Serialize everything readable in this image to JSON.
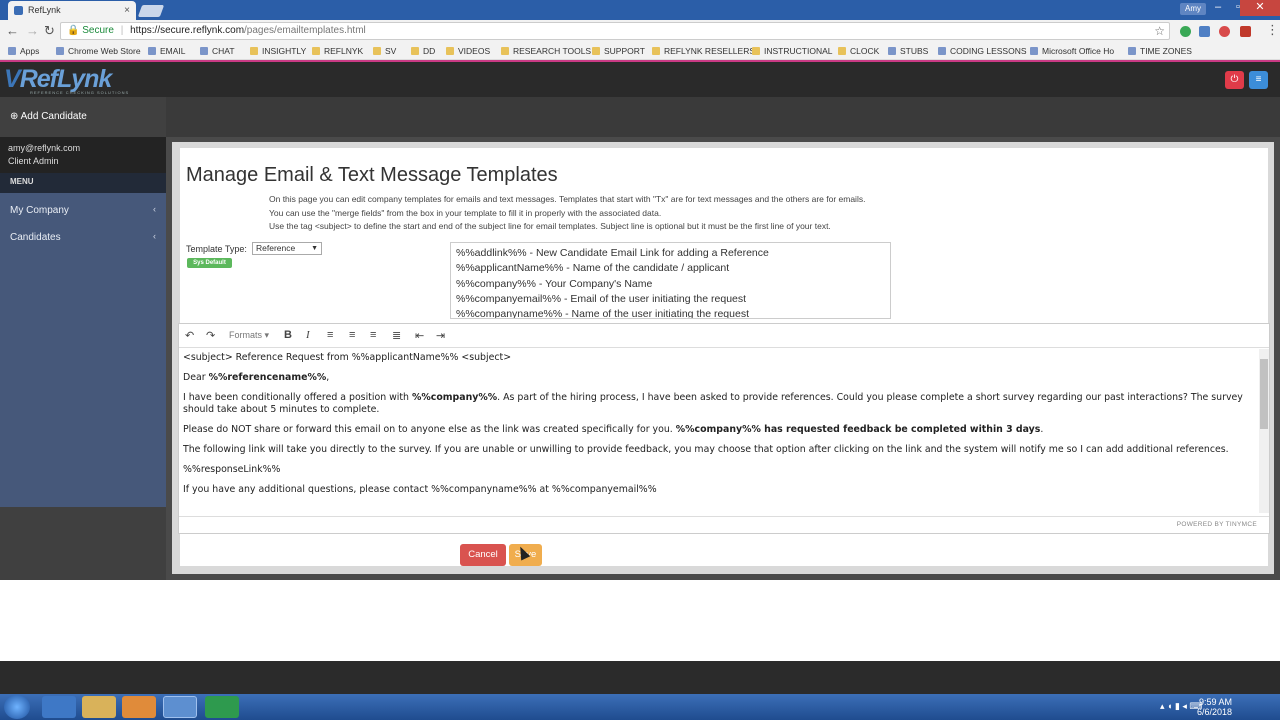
{
  "browser": {
    "tab_title": "RefLynk",
    "tab_close": "×",
    "user_label": "Amy",
    "url_secure": "Secure",
    "url_host": "https://secure.reflynk.com",
    "url_path": "/pages/emailtemplates.html",
    "bookmarks": [
      "Apps",
      "Chrome Web Store",
      "EMAIL",
      "CHAT",
      "INSIGHTLY",
      "REFLNYK",
      "SV",
      "DD",
      "VIDEOS",
      "RESEARCH TOOLS",
      "SUPPORT",
      "REFLYNK RESELLERS",
      "INSTRUCTIONAL",
      "CLOCK",
      "STUBS",
      "CODING LESSONS",
      "Microsoft Office Ho",
      "TIME ZONES"
    ]
  },
  "header": {
    "logo": "RefLynk",
    "logo_tagline": "REFERENCE CHECKING SOLUTIONS",
    "power_icon": "power-icon",
    "menu_icon": "menu-icon",
    "power_color": "#e03b49",
    "menu_color": "#3c8dd8"
  },
  "sidebar": {
    "add_candidate": "Add Candidate",
    "user_email": "amy@reflynk.com",
    "user_role": "Client Admin",
    "menu_header": "MENU",
    "items": [
      {
        "label": "My Company"
      },
      {
        "label": "Candidates"
      }
    ]
  },
  "main": {
    "title": "Manage Email & Text Message Templates",
    "descriptions": [
      "On this page you can edit company templates for emails and text messages. Templates that start with \"Tx\" are for text messages and the others are for emails.",
      "You can use the \"merge fields\" from the box in your template to fill it in properly with the associated data.",
      "Use the tag <subject> to define the start and end of the subject line for email templates. Subject line is optional but it must be the first line of your text."
    ],
    "template_type_label": "Template Type:",
    "template_type_value": "Reference",
    "sys_default_badge": "Sys Default",
    "merge_fields": [
      "%%addlink%% - New Candidate Email Link for adding a Reference",
      "%%applicantName%% - Name of the candidate / applicant",
      "%%company%% - Your Company's Name",
      "%%companyemail%% - Email of the user initiating the request",
      "%%companyname%% - Name of the user initiating the request"
    ]
  },
  "editor": {
    "formats_label": "Formats",
    "subject_line": "<subject> Reference Request from %%applicantName%% <subject>",
    "dear_prefix": "Dear ",
    "dear_field": "%%referencename%%",
    "dear_suffix": ",",
    "p1_a": "I have been conditionally offered a position with ",
    "p1_bold": "%%company%%",
    "p1_b": ". As part of the hiring process, I have been asked to provide references. Could you please complete a short survey regarding our past interactions? The survey should take about 5 minutes to complete.",
    "p2_a": "Please do NOT share or forward this email on to anyone else as the link was created specifically for you. ",
    "p2_bold": "%%company%% has requested feedback be completed within 3 days",
    "p2_b": ".",
    "p3": "The following link will take you directly to the survey. If you are unable or unwilling to provide feedback, you may choose that option after clicking on the link and the system will notify me so I can add additional references.",
    "p4": "%%responseLink%%",
    "p5": "If you have any additional questions, please contact %%companyname%% at %%companyemail%%",
    "powered_by": "POWERED BY TINYMCE"
  },
  "actions": {
    "cancel": "Cancel",
    "save": "Save",
    "cancel_color": "#d9534f",
    "save_color": "#f0ad4e"
  },
  "taskbar": {
    "time": "9:59 AM",
    "date": "6/6/2018"
  }
}
